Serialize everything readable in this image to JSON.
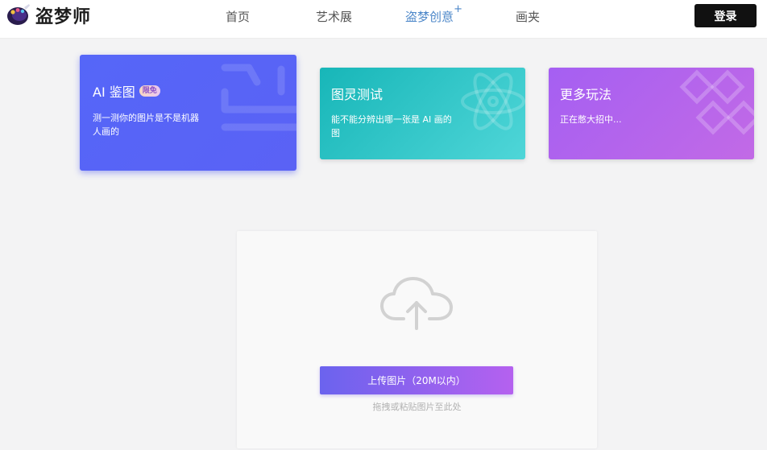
{
  "app": {
    "name": "盗梦师"
  },
  "nav": {
    "items": [
      {
        "label": "首页"
      },
      {
        "label": "艺术展"
      },
      {
        "label": "盗梦创意",
        "superscript": "+"
      },
      {
        "label": "画夹"
      }
    ],
    "active_index": 2
  },
  "login": {
    "label": "登录"
  },
  "cards": {
    "ai": {
      "title": "AI 鉴图",
      "badge": "限免",
      "desc": "测一测你的图片是不是机器人画的"
    },
    "turing": {
      "title": "图灵测试",
      "desc": "能不能分辨出哪一张是 AI 画的图"
    },
    "more": {
      "title": "更多玩法",
      "desc": "正在憋大招中..."
    }
  },
  "upload": {
    "button_label": "上传图片（20M以内）",
    "hint": "拖拽或粘贴图片至此处"
  },
  "colors": {
    "accent_nav": "#4c87c9",
    "card_ai": "#5566f8",
    "card_turing": "#17b6b8",
    "card_more": "#a55ff2",
    "login_bg": "#111111",
    "upload_gradient_start": "#6b63ee",
    "upload_gradient_end": "#b561ef"
  },
  "icons": {
    "logo": "palette-icon",
    "ai_card_deco": "steam-outline-icon",
    "turing_card_deco": "atom-icon",
    "more_card_deco": "diamond-grid-icon",
    "upload": "cloud-upload-icon"
  }
}
